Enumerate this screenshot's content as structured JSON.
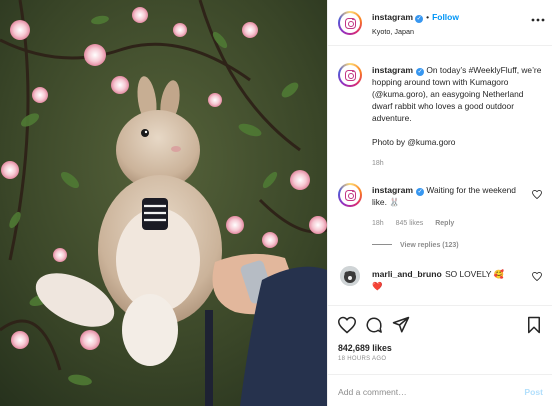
{
  "header": {
    "username": "instagram",
    "separator": "•",
    "follow_label": "Follow",
    "location": "Kyoto, Japan"
  },
  "caption": {
    "username": "instagram",
    "text": "On today’s #WeeklyFluff, we’re hopping around town with Kumagoro (@kuma.goro), an easygoing Netherland dwarf rabbit who loves a good outdoor adventure.",
    "credit": "Photo by @kuma.goro",
    "time": "18h"
  },
  "comments": [
    {
      "username": "instagram",
      "text": "Waiting for the weekend like. 🐰",
      "time": "18h",
      "likes": "845 likes",
      "reply_label": "Reply",
      "view_replies": "View replies (123)"
    },
    {
      "username": "marli_and_bruno",
      "text": "SO LOVELY 🥰",
      "extra": "❤️"
    }
  ],
  "actions": {
    "likes_count": "842,689 likes",
    "timestamp": "18 HOURS AGO"
  },
  "add_comment": {
    "placeholder": "Add a comment…",
    "post_label": "Post"
  },
  "colors": {
    "link_blue": "#0095f6",
    "verified_blue": "#3897f0",
    "post_disabled": "#b2dffc",
    "muted_text": "#8e8e8e"
  }
}
